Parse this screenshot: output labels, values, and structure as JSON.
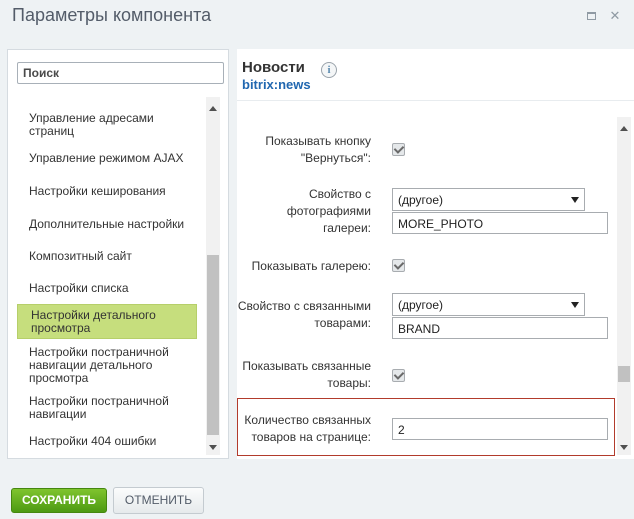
{
  "window": {
    "title": "Параметры компонента"
  },
  "sidebar": {
    "search_placeholder": "Поиск",
    "items": [
      {
        "label": "Управление адресами страниц"
      },
      {
        "label": "Управление режимом AJAX"
      },
      {
        "label": "Настройки кеширования"
      },
      {
        "label": "Дополнительные настройки"
      },
      {
        "label": "Композитный сайт"
      },
      {
        "label": "Настройки списка"
      },
      {
        "label": "Настройки детального просмотра",
        "active": true
      },
      {
        "label": "Настройки постраничной навигации детального просмотра"
      },
      {
        "label": "Настройки постраничной навигации"
      },
      {
        "label": "Настройки 404 ошибки"
      }
    ]
  },
  "component": {
    "title": "Новости",
    "code": "bitrix:news",
    "info_icon": "info-icon"
  },
  "form": {
    "show_back_link": {
      "label": "Показывать кнопку \"Вернуться\":",
      "checked": true
    },
    "gallery_property": {
      "label": "Свойство с фотографиями галереи:",
      "select_value": "(другое)",
      "input_value": "MORE_PHOTO"
    },
    "show_gallery": {
      "label": "Показывать галерею:",
      "checked": true
    },
    "linked_goods_property": {
      "label": "Свойство с связанными товарами:",
      "select_value": "(другое)",
      "input_value": "BRAND"
    },
    "show_linked_goods": {
      "label": "Показывать связанные товары:",
      "checked": true
    },
    "linked_goods_count": {
      "label": "Количество связанных товаров на странице:",
      "value": "2"
    }
  },
  "footer": {
    "save_label": "Сохранить",
    "cancel_label": "Отменить"
  },
  "colors": {
    "accent_green": "#6db423",
    "active_item": "#c6de7d",
    "highlight_border": "#b23b2c",
    "link_blue": "#2067b0"
  }
}
